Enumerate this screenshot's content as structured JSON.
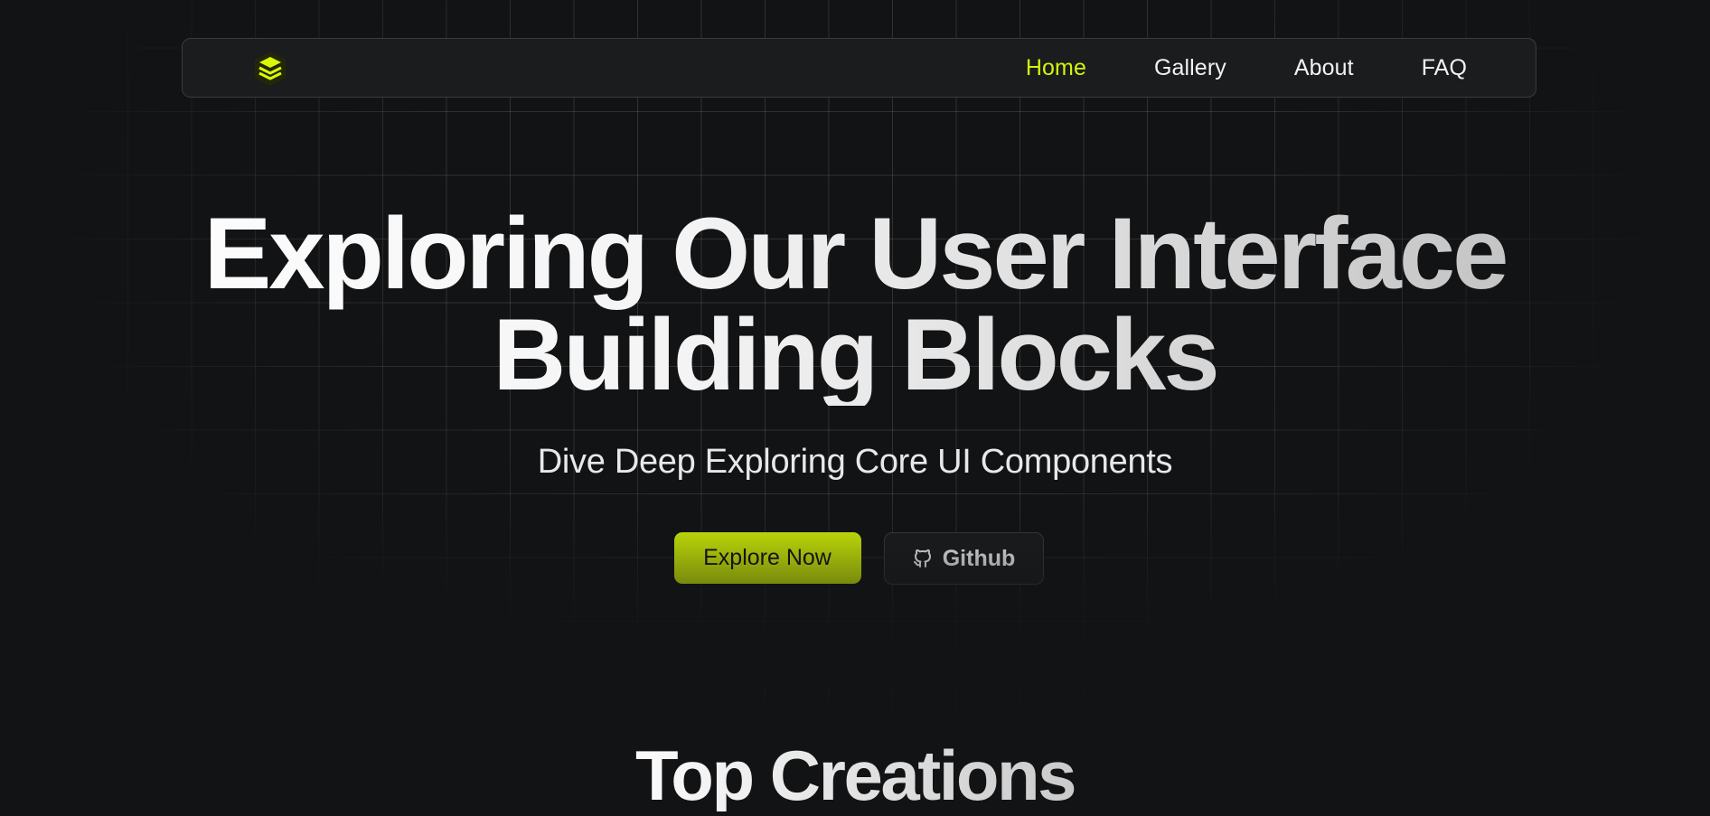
{
  "theme": {
    "background": "#121315",
    "accent": "#d9fa06",
    "nav_active": "#d4f30c",
    "surface": "#1b1c1e"
  },
  "nav": {
    "logo_icon": "layers-icon",
    "links": [
      {
        "label": "Home",
        "active": true
      },
      {
        "label": "Gallery",
        "active": false
      },
      {
        "label": "About",
        "active": false
      },
      {
        "label": "FAQ",
        "active": false
      }
    ]
  },
  "hero": {
    "title_line1": "Exploring Our User Interface",
    "title_line2": "Building Blocks",
    "subtitle": "Dive Deep Exploring Core UI Components",
    "primary_button": "Explore Now",
    "secondary_button": "Github",
    "secondary_icon": "github-icon"
  },
  "section": {
    "title": "Top Creations"
  }
}
